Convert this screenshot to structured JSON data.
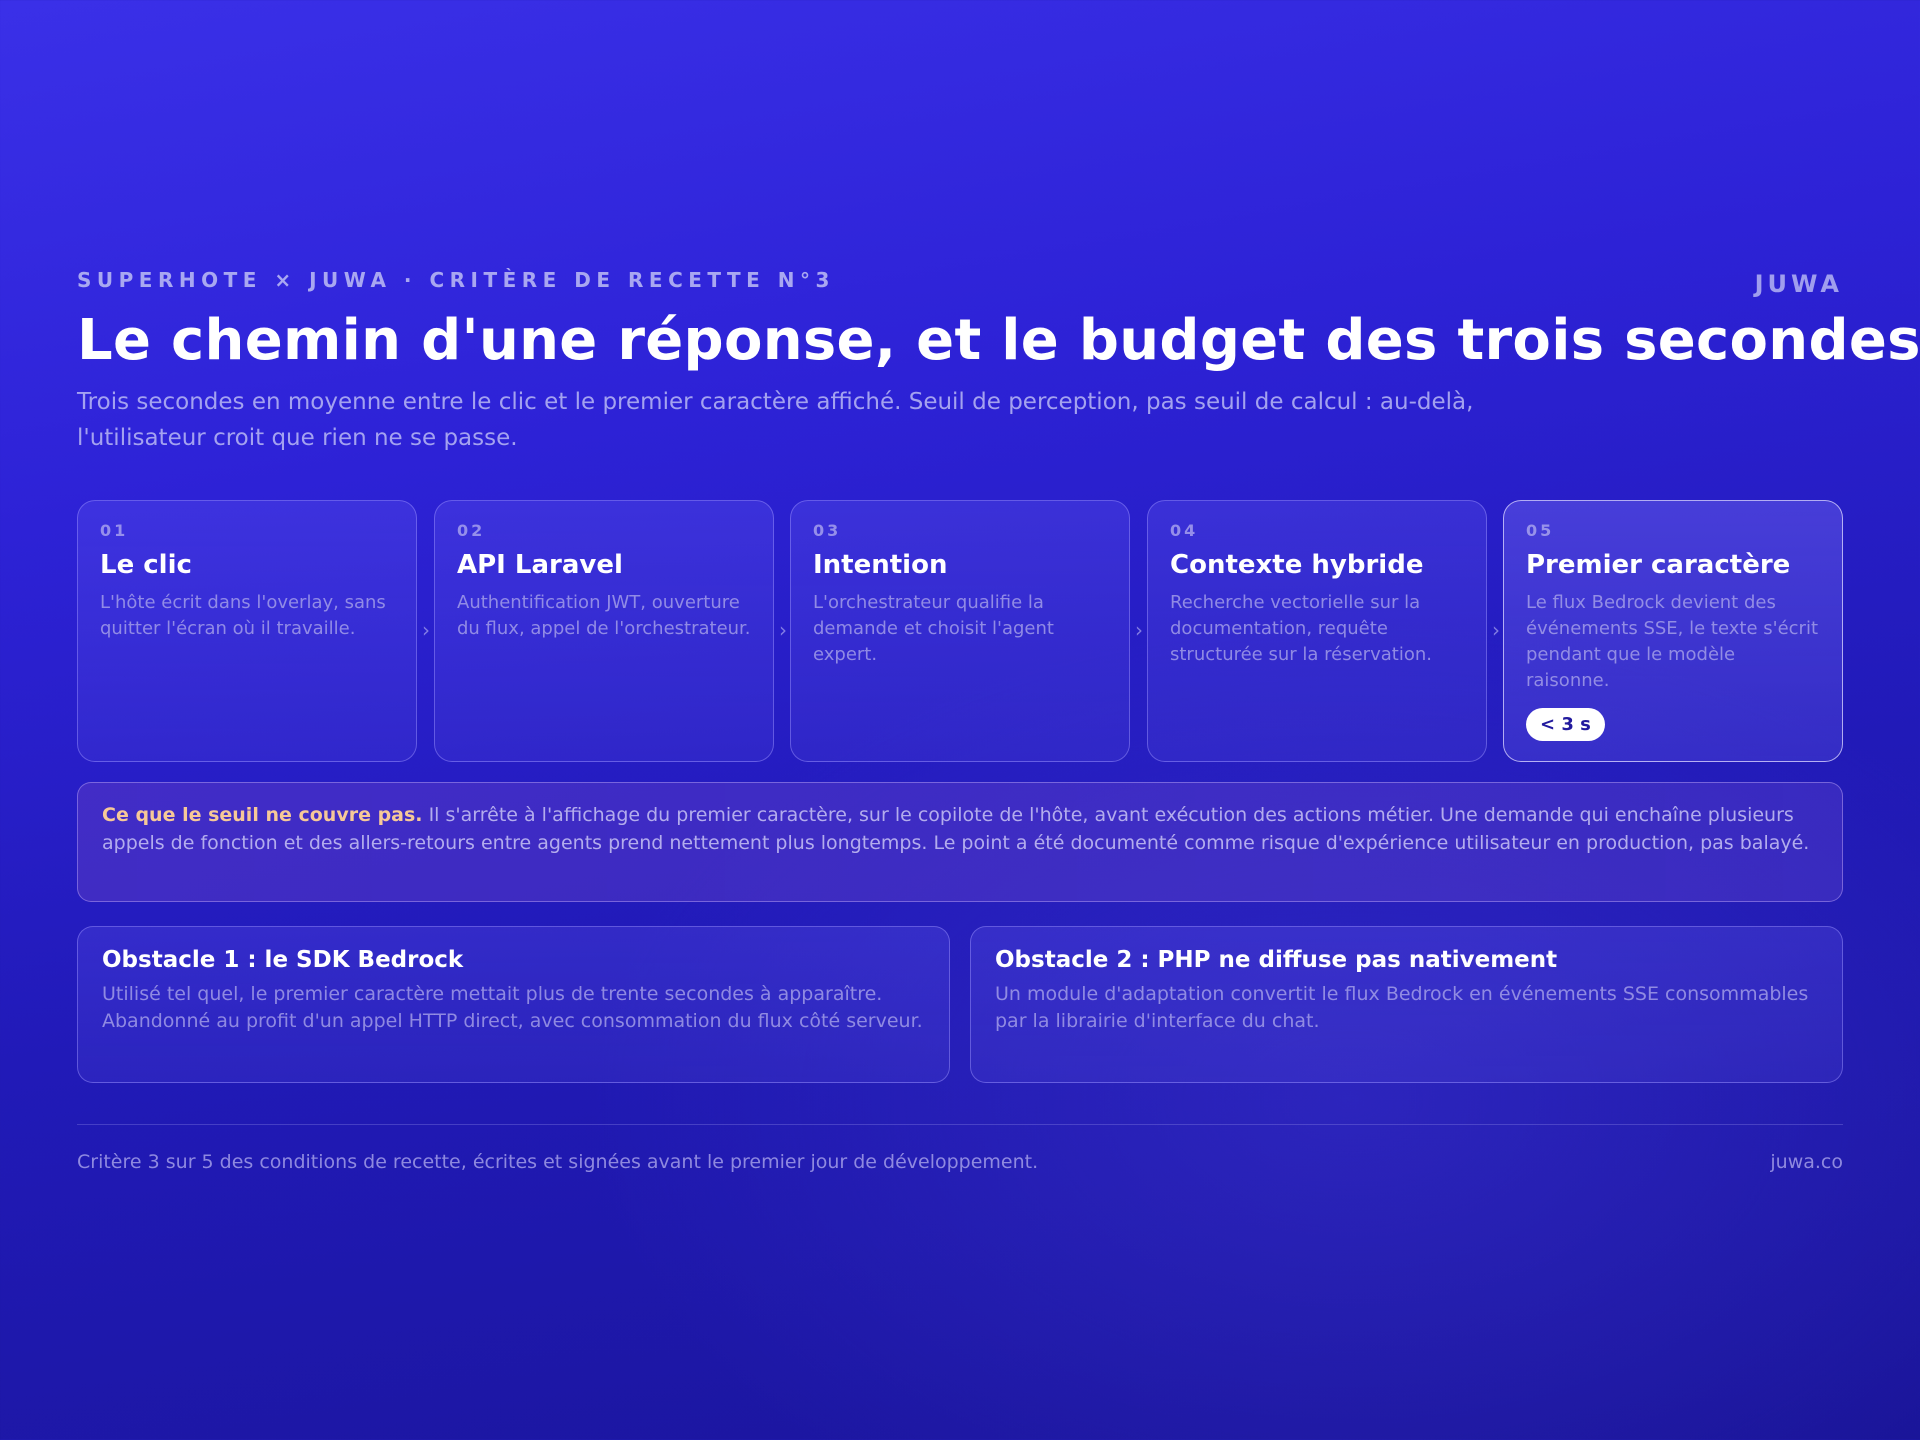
{
  "header": {
    "eyebrow": "SUPERHOTE × JUWA · CRITÈRE DE RECETTE N°3",
    "brand": "JUWA",
    "title": "Le chemin d'une réponse, et le budget des trois secondes",
    "subtitle": "Trois secondes en moyenne entre le clic et le premier caractère affiché. Seuil de perception, pas seuil de calcul : au-delà, l'utilisateur croit que rien ne se passe."
  },
  "steps": [
    {
      "num": "01",
      "title": "Le clic",
      "desc": "L'hôte écrit dans l'overlay, sans quitter l'écran où il travaille."
    },
    {
      "num": "02",
      "title": "API Laravel",
      "desc": "Authentification JWT, ouverture du flux, appel de l'orchestrateur."
    },
    {
      "num": "03",
      "title": "Intention",
      "desc": "L'orchestrateur qualifie la demande et choisit l'agent expert."
    },
    {
      "num": "04",
      "title": "Contexte hybride",
      "desc": "Recherche vectorielle sur la documentation, requête structurée sur la réservation."
    },
    {
      "num": "05",
      "title": "Premier caractère",
      "desc": "Le flux Bedrock devient des événements SSE, le texte s'écrit pendant que le modèle raisonne.",
      "badge": "< 3 s"
    }
  ],
  "arrows": [
    "›",
    "›",
    "›",
    "›"
  ],
  "note": {
    "lead": "Ce que le seuil ne couvre pas.",
    "text": " Il s'arrête à l'affichage du premier caractère, sur le copilote de l'hôte, avant exécution des actions métier. Une demande qui enchaîne plusieurs appels de fonction et des allers-retours entre agents prend nettement plus longtemps. Le point a été documenté comme risque d'expérience utilisateur en production, pas balayé."
  },
  "obstacles": [
    {
      "title": "Obstacle 1 : le SDK Bedrock",
      "desc": "Utilisé tel quel, le premier caractère mettait plus de trente secondes à apparaître. Abandonné au profit d'un appel HTTP direct, avec consommation du flux côté serveur."
    },
    {
      "title": "Obstacle 2 : PHP ne diffuse pas nativement",
      "desc": "Un module d'adaptation convertit le flux Bedrock en événements SSE consommables par la librairie d'interface du chat."
    }
  ],
  "footer": {
    "text": "Critère 3 sur 5 des conditions de recette, écrites et signées avant le premier jour de développement.",
    "link": "juwa.co"
  }
}
